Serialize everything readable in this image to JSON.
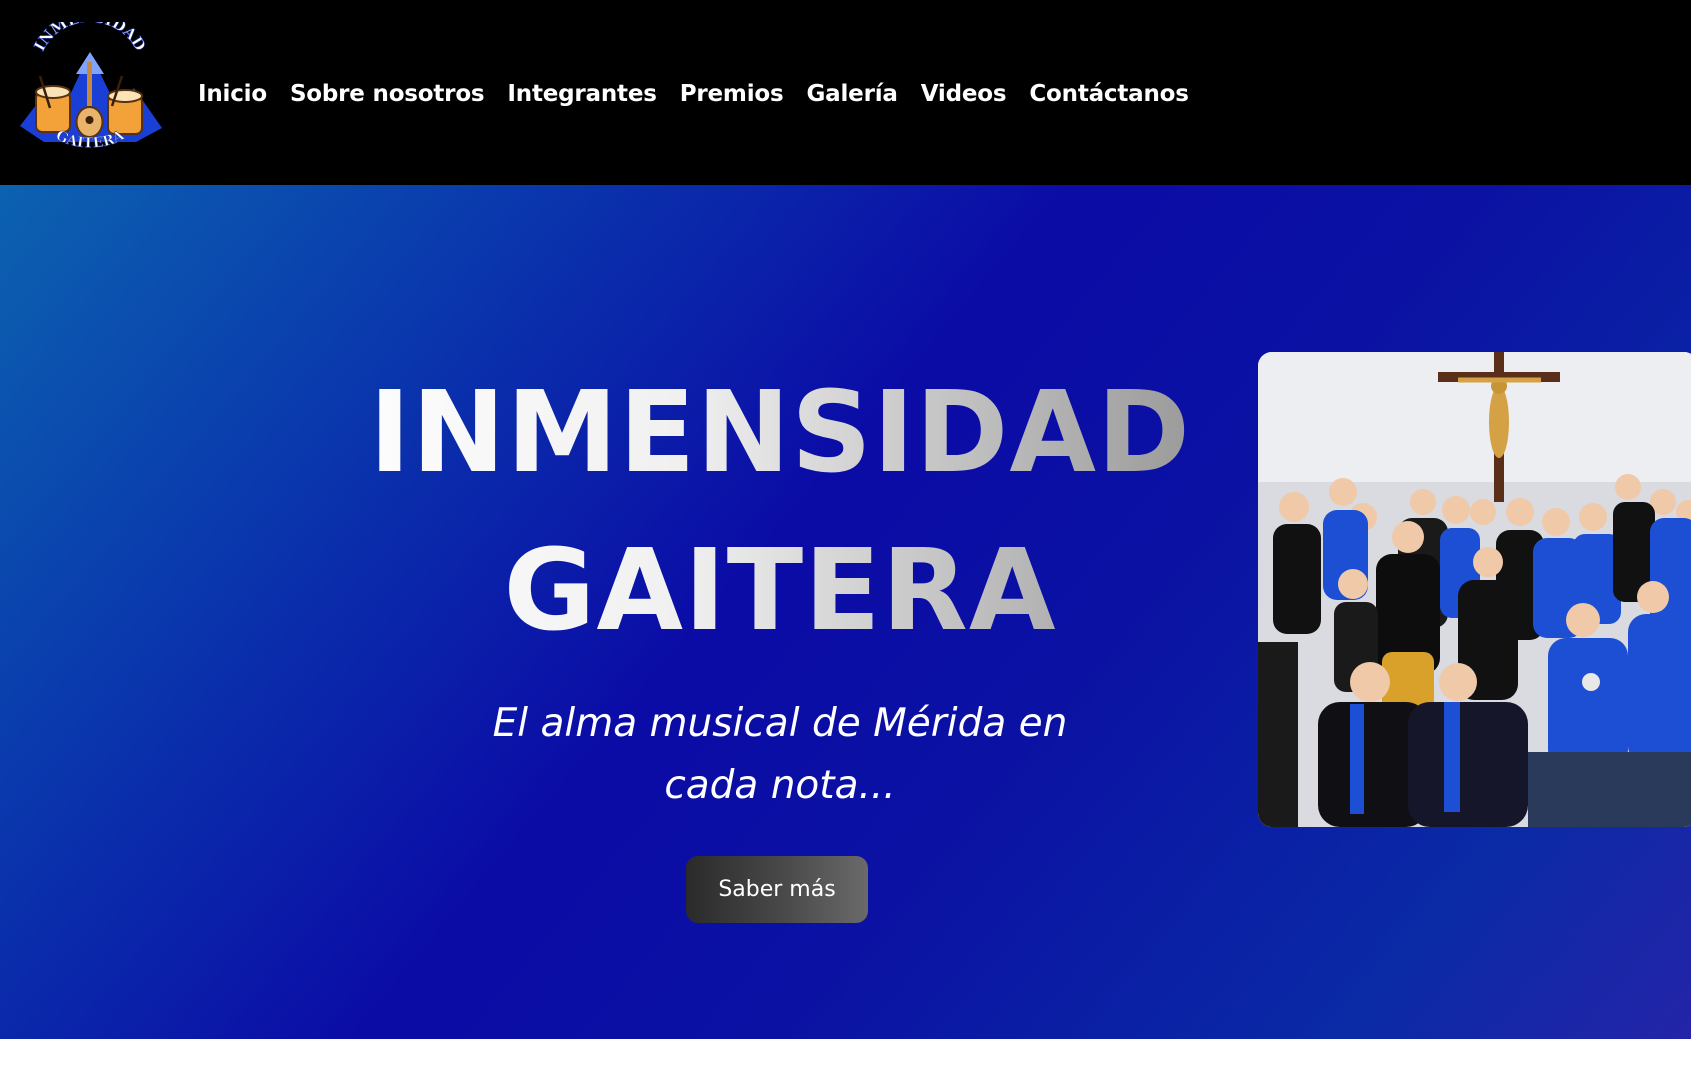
{
  "brand": {
    "logo_alt": "Inmensidad Gaitera logo",
    "logo_top_text": "INMENSIDAD",
    "logo_bottom_text": "GAITERA"
  },
  "nav": {
    "items": [
      {
        "label": "Inicio"
      },
      {
        "label": "Sobre nosotros"
      },
      {
        "label": "Integrantes"
      },
      {
        "label": "Premios"
      },
      {
        "label": "Galería"
      },
      {
        "label": "Videos"
      },
      {
        "label": "Contáctanos"
      }
    ]
  },
  "hero": {
    "title_line1": "INMENSIDAD",
    "title_line2": "GAITERA",
    "tagline": "El alma musical de Mérida en cada nota...",
    "cta_label": "Saber más",
    "photo_alt": "Grupo Inmensidad Gaitera posando frente a un crucifijo"
  },
  "colors": {
    "topbar": "#000000",
    "hero_gradient_start": "#0c62b0",
    "hero_gradient_mid": "#0b0ba6",
    "cta_dark": "#2a2a2a",
    "text": "#ffffff"
  }
}
